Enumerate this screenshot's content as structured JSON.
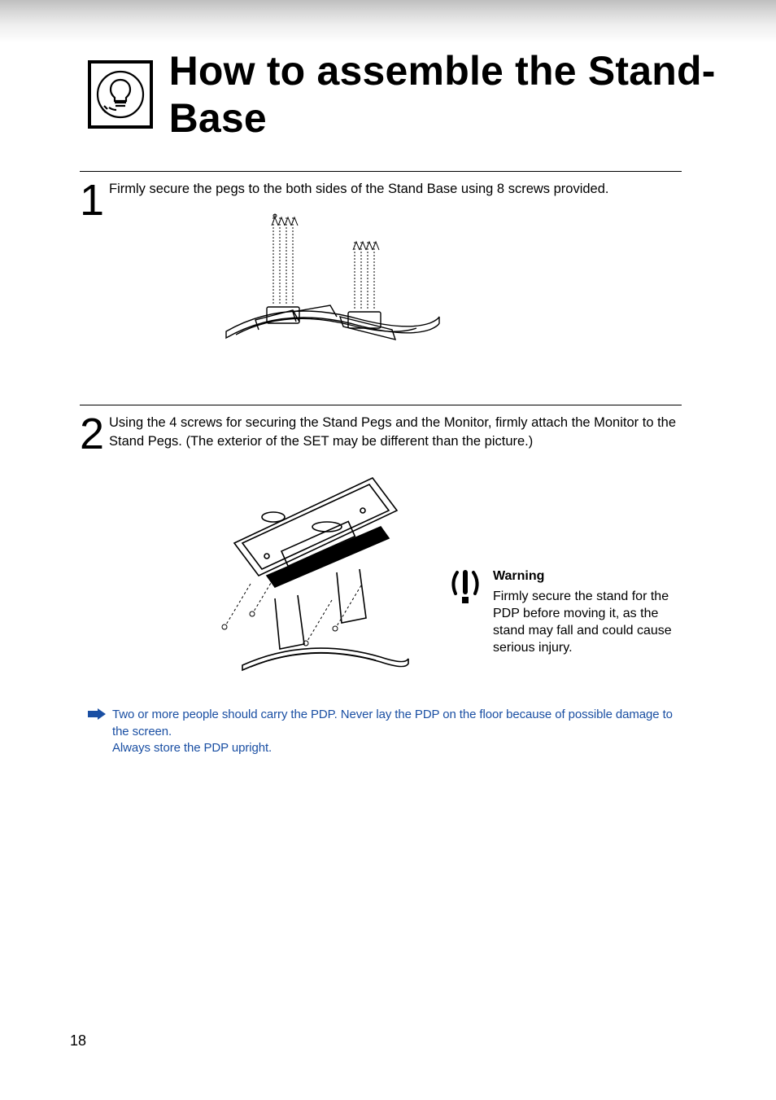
{
  "title": "How to assemble the Stand-Base",
  "steps": [
    {
      "num": "1",
      "text": "Firmly secure the pegs to the both sides of the Stand Base using 8 screws provided."
    },
    {
      "num": "2",
      "text": "Using the 4 screws for securing the Stand Pegs and the Monitor, firmly attach the Monitor to the Stand Pegs. (The exterior of the SET may be different than the picture.)"
    }
  ],
  "warning": {
    "title": "Warning",
    "body": "Firmly secure the stand for the PDP before moving it, as the stand may fall and could cause serious injury."
  },
  "note": {
    "line1": "Two or more people should carry the PDP. Never lay the PDP on the floor because of possible damage to the screen.",
    "line2": "Always store the PDP upright."
  },
  "page_number": "18",
  "icons": {
    "header": "lightbulb-hand-icon",
    "warning": "exclamation-icon",
    "note_arrow": "arrow-right-icon"
  }
}
